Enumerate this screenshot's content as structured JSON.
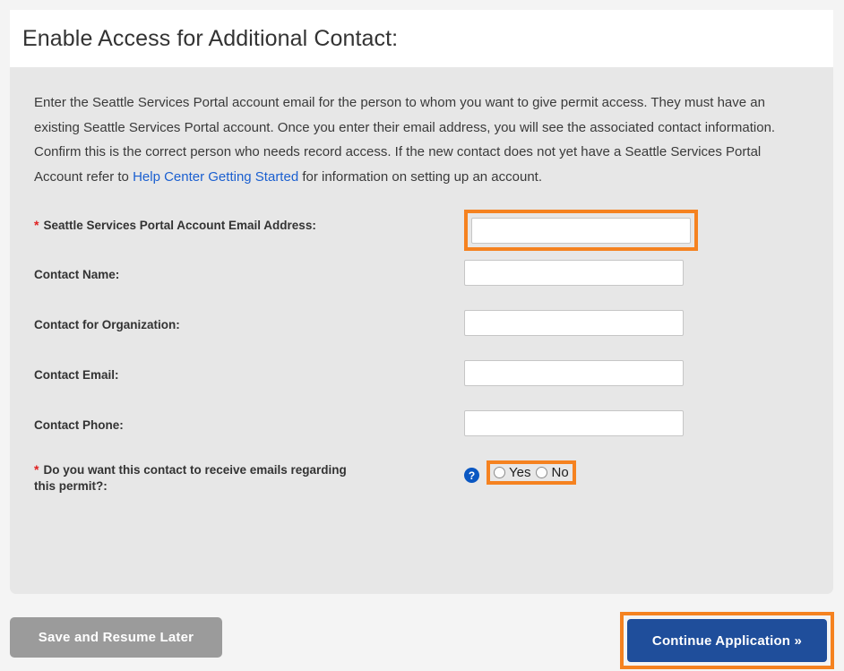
{
  "page": {
    "title": "Enable Access for Additional Contact:"
  },
  "intro": {
    "before_link": "Enter the Seattle Services Portal account email for the person to whom you want to give permit access. They must have an existing Seattle Services Portal account. Once you enter their email address, you will see the associated contact information. Confirm this is the correct person who needs record access. If the new contact does not yet have a Seattle Services Portal Account refer to ",
    "link_text": "Help Center Getting Started",
    "after_link": " for information on setting up an account."
  },
  "form": {
    "required_marker": "*",
    "fields": [
      {
        "label": "Seattle Services Portal Account Email Address:",
        "required": true,
        "value": "",
        "highlighted": true
      },
      {
        "label": "Contact Name:",
        "required": false,
        "value": "",
        "highlighted": false
      },
      {
        "label": "Contact for Organization:",
        "required": false,
        "value": "",
        "highlighted": false
      },
      {
        "label": "Contact Email:",
        "required": false,
        "value": "",
        "highlighted": false
      },
      {
        "label": "Contact Phone:",
        "required": false,
        "value": "",
        "highlighted": false
      }
    ],
    "radio_question": {
      "label_line1": "Do you want this contact to receive emails regarding",
      "label_line2": "this permit?:",
      "required": true,
      "help_icon": "question-mark-icon",
      "help_icon_glyph": "?",
      "options": [
        {
          "label": "Yes",
          "selected": false
        },
        {
          "label": "No",
          "selected": false
        }
      ]
    }
  },
  "footer": {
    "save_label": "Save and Resume Later",
    "continue_label": "Continue Application »"
  },
  "colors": {
    "highlight_orange": "#f58220",
    "primary_blue": "#1f4e9b",
    "link_blue": "#1a5fd0",
    "save_gray": "#9b9b9b",
    "panel_gray": "#e7e7e7",
    "page_bg": "#f4f4f4",
    "required_red": "#e02020"
  }
}
